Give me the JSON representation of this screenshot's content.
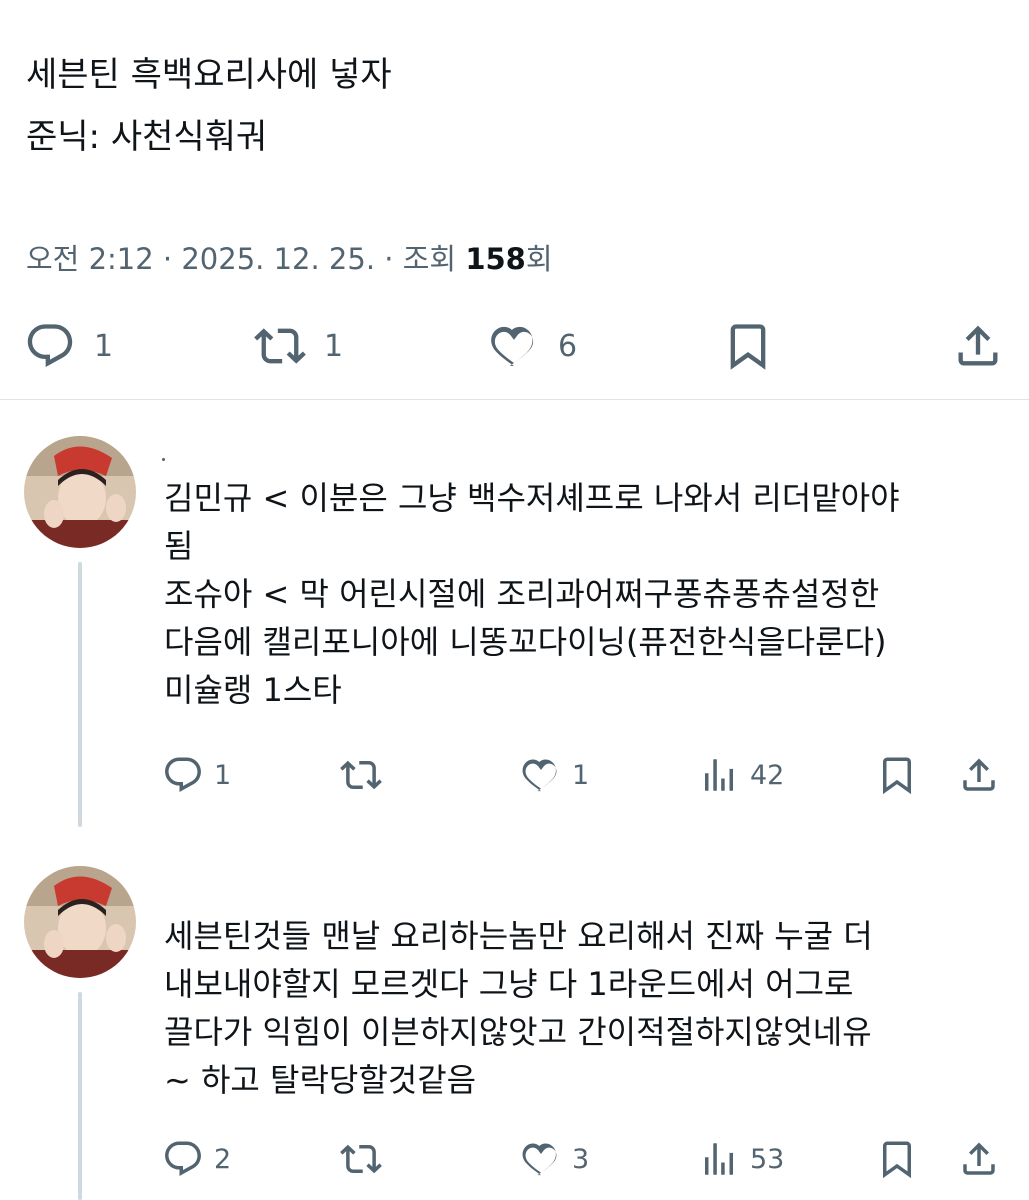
{
  "post": {
    "lines": [
      "세븐틴 흑백요리사에 넣자",
      "준닉: 사천식훠궈"
    ],
    "time": "오전 2:12",
    "date": "2025. 12. 25.",
    "views_label": "조회",
    "views": "158",
    "views_suffix": "회",
    "separator": "·",
    "replies": "1",
    "reposts": "1",
    "likes": "6"
  },
  "replies": [
    {
      "lines": [
        "김민규 < 이분은 그냥 백수저셰프로 나와서 리더맡아야",
        "됨",
        "조슈아 < 막 어린시절에 조리과어쩌구퐁츄퐁츄설정한",
        "다음에 캘리포니아에 니똥꼬다이닝(퓨전한식을다룬다)",
        "미슐랭 1스타"
      ],
      "replies": "1",
      "reposts": "",
      "likes": "1",
      "views": "42"
    },
    {
      "lines": [
        "세븐틴것들 맨날 요리하는놈만 요리해서 진짜 누굴 더",
        "내보내야할지 모르겟다 그냥 다 1라운드에서 어그로",
        "끌다가 익힘이 이븐하지않앗고 간이적절하지않엇네유",
        "~ 하고 탈락당할것같음"
      ],
      "replies": "2",
      "reposts": "",
      "likes": "3",
      "views": "53"
    }
  ],
  "colors": {
    "text": "#0f1419",
    "secondary": "#536471",
    "divider": "#dfe3e7"
  },
  "icons": [
    "reply-icon",
    "repost-icon",
    "like-icon",
    "bookmark-icon",
    "share-icon",
    "views-icon"
  ]
}
